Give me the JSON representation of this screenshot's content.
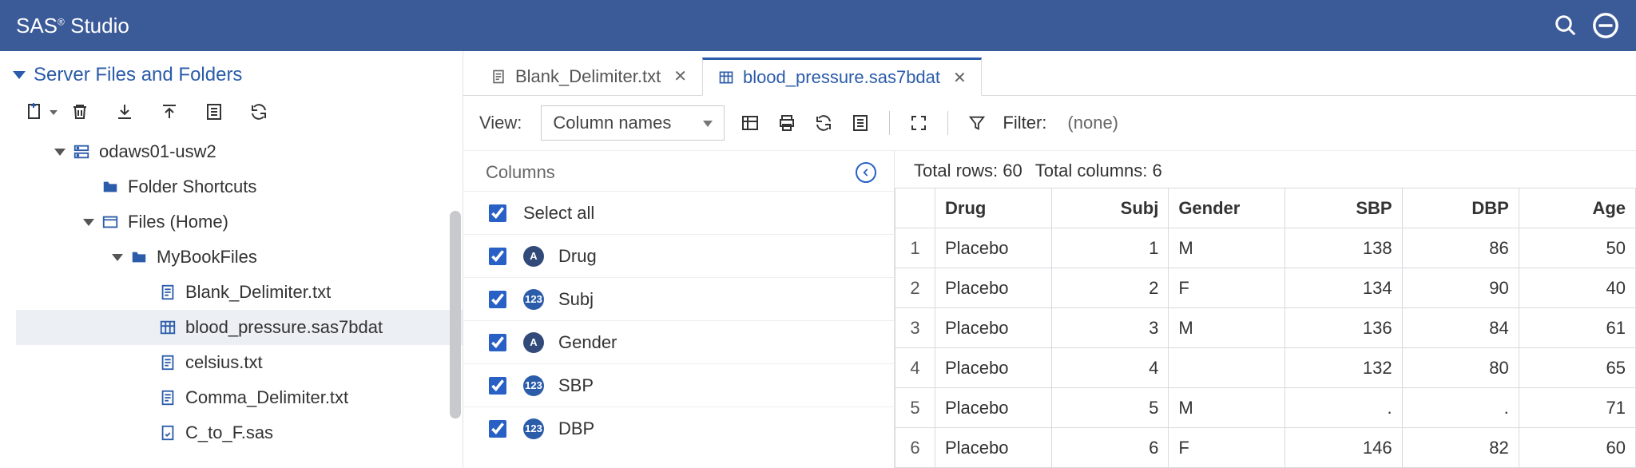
{
  "titlebar": {
    "brand_prefix": "SAS",
    "brand_suffix": " Studio"
  },
  "sidebar": {
    "title": "Server Files and Folders",
    "tree": {
      "server": "odaws01-usw2",
      "shortcuts": "Folder Shortcuts",
      "files_home": "Files (Home)",
      "folder": "MyBookFiles",
      "files": [
        {
          "name": "Blank_Delimiter.txt",
          "kind": "txt"
        },
        {
          "name": "blood_pressure.sas7bdat",
          "kind": "data",
          "selected": true
        },
        {
          "name": "celsius.txt",
          "kind": "txt"
        },
        {
          "name": "Comma_Delimiter.txt",
          "kind": "txt"
        },
        {
          "name": "C_to_F.sas",
          "kind": "sas"
        }
      ]
    }
  },
  "tabs": [
    {
      "label": "Blank_Delimiter.txt",
      "kind": "txt",
      "active": false
    },
    {
      "label": "blood_pressure.sas7bdat",
      "kind": "data",
      "active": true
    }
  ],
  "toolbar": {
    "view_label": "View:",
    "view_value": "Column names",
    "filter_label": "Filter:",
    "filter_value": "(none)"
  },
  "columns_panel": {
    "title": "Columns",
    "select_all": "Select all",
    "items": [
      {
        "name": "Drug",
        "type": "A"
      },
      {
        "name": "Subj",
        "type": "123"
      },
      {
        "name": "Gender",
        "type": "A"
      },
      {
        "name": "SBP",
        "type": "123"
      },
      {
        "name": "DBP",
        "type": "123"
      }
    ]
  },
  "data_summary": {
    "rows_label": "Total rows:",
    "rows": 60,
    "cols_label": "Total columns:",
    "cols": 6
  },
  "data_table": {
    "headers": [
      "Drug",
      "Subj",
      "Gender",
      "SBP",
      "DBP",
      "Age"
    ],
    "numeric_cols": [
      false,
      true,
      false,
      true,
      true,
      true
    ],
    "rows": [
      [
        "Placebo",
        "1",
        "M",
        "138",
        "86",
        "50"
      ],
      [
        "Placebo",
        "2",
        "F",
        "134",
        "90",
        "40"
      ],
      [
        "Placebo",
        "3",
        "M",
        "136",
        "84",
        "61"
      ],
      [
        "Placebo",
        "4",
        "",
        "132",
        "80",
        "65"
      ],
      [
        "Placebo",
        "5",
        "M",
        ".",
        ".",
        "71"
      ],
      [
        "Placebo",
        "6",
        "F",
        "146",
        "82",
        "60"
      ]
    ]
  }
}
